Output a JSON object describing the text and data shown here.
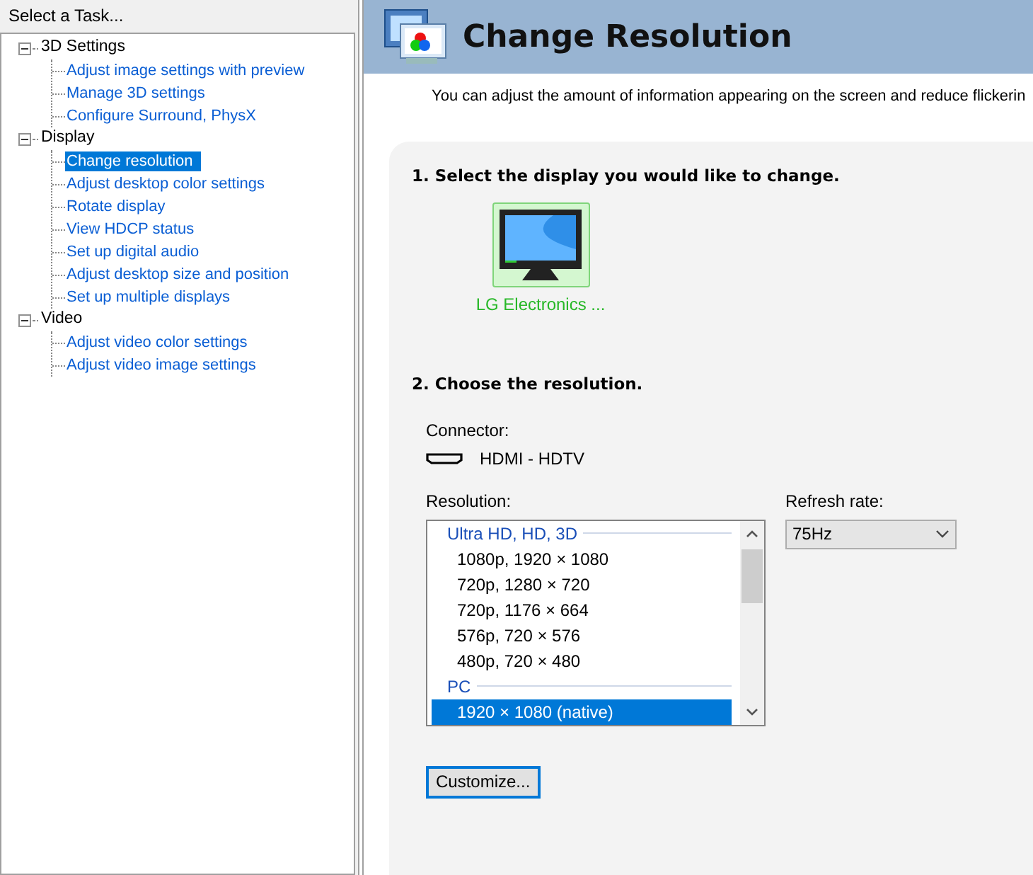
{
  "sidebar": {
    "title": "Select a Task...",
    "tree": [
      {
        "label": "3D Settings",
        "expanded": true,
        "selected": false,
        "children": [
          {
            "label": "Adjust image settings with preview",
            "selected": false
          },
          {
            "label": "Manage 3D settings",
            "selected": false
          },
          {
            "label": "Configure Surround, PhysX",
            "selected": false
          }
        ]
      },
      {
        "label": "Display",
        "expanded": true,
        "selected": false,
        "children": [
          {
            "label": "Change resolution",
            "selected": true
          },
          {
            "label": "Adjust desktop color settings",
            "selected": false
          },
          {
            "label": "Rotate display",
            "selected": false
          },
          {
            "label": "View HDCP status",
            "selected": false
          },
          {
            "label": "Set up digital audio",
            "selected": false
          },
          {
            "label": "Adjust desktop size and position",
            "selected": false
          },
          {
            "label": "Set up multiple displays",
            "selected": false
          }
        ]
      },
      {
        "label": "Video",
        "expanded": true,
        "selected": false,
        "children": [
          {
            "label": "Adjust video color settings",
            "selected": false
          },
          {
            "label": "Adjust video image settings",
            "selected": false
          }
        ]
      }
    ]
  },
  "page": {
    "title": "Change Resolution",
    "description": "You can adjust the amount of information appearing on the screen and reduce flickerin",
    "step1": {
      "heading": "1. Select the display you would like to change.",
      "displays": [
        {
          "label": "LG Electronics ...",
          "selected": true
        }
      ]
    },
    "step2": {
      "heading": "2. Choose the resolution.",
      "connector_label": "Connector:",
      "connector": "HDMI - HDTV",
      "resolution_label": "Resolution:",
      "resolution_groups": [
        {
          "header": "Ultra HD, HD, 3D",
          "items": [
            {
              "label": "1080p, 1920 × 1080",
              "selected": false
            },
            {
              "label": "720p, 1280 × 720",
              "selected": false
            },
            {
              "label": "720p, 1176 × 664",
              "selected": false
            },
            {
              "label": "576p, 720 × 576",
              "selected": false
            },
            {
              "label": "480p, 720 × 480",
              "selected": false
            }
          ]
        },
        {
          "header": "PC",
          "items": [
            {
              "label": "1920 × 1080 (native)",
              "selected": true
            }
          ]
        }
      ],
      "refresh_label": "Refresh rate:",
      "refresh_rate": "75Hz",
      "customize_button": "Customize..."
    }
  }
}
